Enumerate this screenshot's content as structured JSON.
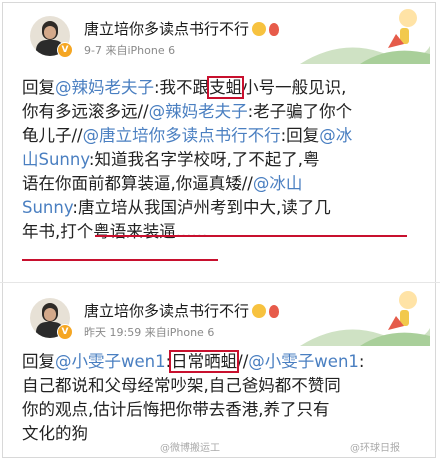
{
  "posts": [
    {
      "username": "唐立培你多读点书行不行",
      "meta": "9-7  来自iPhone 6",
      "lines": [
        [
          {
            "t": "回复"
          },
          {
            "t": "@辣妈老夫子",
            "link": true
          },
          {
            "t": ":我不跟"
          },
          {
            "t": "支蛆",
            "box": true
          },
          {
            "t": "小号一般见识,"
          }
        ],
        [
          {
            "t": "你有多远滚多远//"
          },
          {
            "t": "@辣妈老夫子",
            "link": true
          },
          {
            "t": ":老子骗了你个"
          }
        ],
        [
          {
            "t": "龟儿子//"
          },
          {
            "t": "@唐立培你多读点书行不行",
            "link": true
          },
          {
            "t": ":回复"
          },
          {
            "t": "@冰",
            "link": true
          }
        ],
        [
          {
            "t": "山Sunny",
            "link": true
          },
          {
            "t": ":知道我名字学校呀,了不起了,粤"
          }
        ],
        [
          {
            "t": "语在你面前都算装逼,你逼真矮//"
          },
          {
            "t": "@冰山",
            "link": true
          }
        ],
        [
          {
            "t": "Sunny",
            "link": true
          },
          {
            "t": ":唐立培从我国泸州考到中大,读了几"
          }
        ],
        [
          {
            "t": "年书,打个粤语来装逼......"
          }
        ]
      ]
    },
    {
      "username": "唐立培你多读点书行不行",
      "meta": "昨天 19:59  来自iPhone 6",
      "lines": [
        [
          {
            "t": "回复"
          },
          {
            "t": "@小雯子wen1",
            "link": true
          },
          {
            "t": ":"
          },
          {
            "t": "日常晒蛆",
            "box": true
          },
          {
            "t": "//"
          },
          {
            "t": "@小雯子wen1",
            "link": true
          },
          {
            "t": ":"
          }
        ],
        [
          {
            "t": "自己都说和父母经常吵架,自己爸妈都不赞同"
          }
        ],
        [
          {
            "t": "你的观点,估计后悔把你带去香港,养了只有"
          }
        ],
        [
          {
            "t": "文化的狗"
          }
        ]
      ]
    }
  ],
  "watermark": {
    "left": "@微博搬运工",
    "right": "@环球日报"
  },
  "colors": {
    "link": "#4a7fc1",
    "highlight": "#c8102e",
    "badge": "#f5a623"
  },
  "icons": {
    "verified": "verified-badge-icon",
    "emoji": "grin-emoji-icon",
    "balloon": "balloon-icon"
  }
}
